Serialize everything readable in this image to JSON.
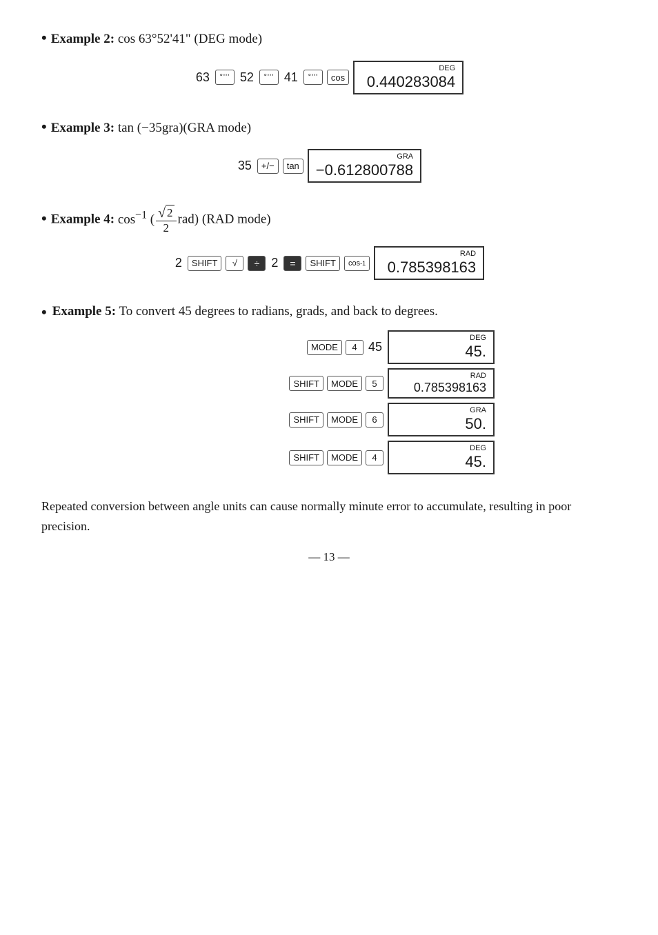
{
  "examples": [
    {
      "id": "ex2",
      "bullet": "•",
      "title_bold": "Example 2:",
      "title_rest": " cos 63°52'41\" (DEG mode)",
      "keys": [
        {
          "type": "number",
          "value": "63"
        },
        {
          "type": "dots",
          "value": "°'''"
        },
        {
          "type": "number",
          "value": "52"
        },
        {
          "type": "dots",
          "value": "°'''"
        },
        {
          "type": "number",
          "value": "41"
        },
        {
          "type": "dots",
          "value": "°'''"
        },
        {
          "type": "key",
          "value": "cos"
        }
      ],
      "display_mode": "DEG",
      "display_value": "0.440283084"
    },
    {
      "id": "ex3",
      "bullet": "•",
      "title_bold": "Example 3:",
      "title_rest": " tan (−35gra)(GRA mode)",
      "keys": [
        {
          "type": "number",
          "value": "35"
        },
        {
          "type": "key",
          "value": "+/−"
        },
        {
          "type": "key",
          "value": "tan"
        }
      ],
      "display_mode": "GRA",
      "display_value": "−0.612800788"
    },
    {
      "id": "ex4",
      "bullet": "•",
      "title_bold": "Example 4:",
      "title_rest": " (RAD mode)",
      "display_mode": "RAD",
      "display_value": "0.785398163"
    }
  ],
  "example5": {
    "bullet": "•",
    "title_bold": "Example 5:",
    "title_rest": " To convert 45 degrees to radians, grads, and back to degrees.",
    "rows": [
      {
        "keys_label": "MODE  4  45",
        "display_mode": "DEG",
        "display_value": "45."
      },
      {
        "keys_label": "SHIFT  MODE  5",
        "display_mode": "RAD",
        "display_value": "0.785398163"
      },
      {
        "keys_label": "SHIFT  MODE  6",
        "display_mode": "GRA",
        "display_value": "50."
      },
      {
        "keys_label": "SHIFT  MODE  4",
        "display_mode": "DEG",
        "display_value": "45."
      }
    ]
  },
  "paragraph": "Repeated conversion between angle units can cause normally minute error to accumulate, resulting in poor precision.",
  "page_number": "— 13 —",
  "keys": {
    "mode": "MODE",
    "shift": "SHIFT",
    "cos": "cos",
    "tan": "tan",
    "cos_inv": "cos⁻¹",
    "sqrt": "√",
    "div": "÷",
    "eq": "="
  }
}
